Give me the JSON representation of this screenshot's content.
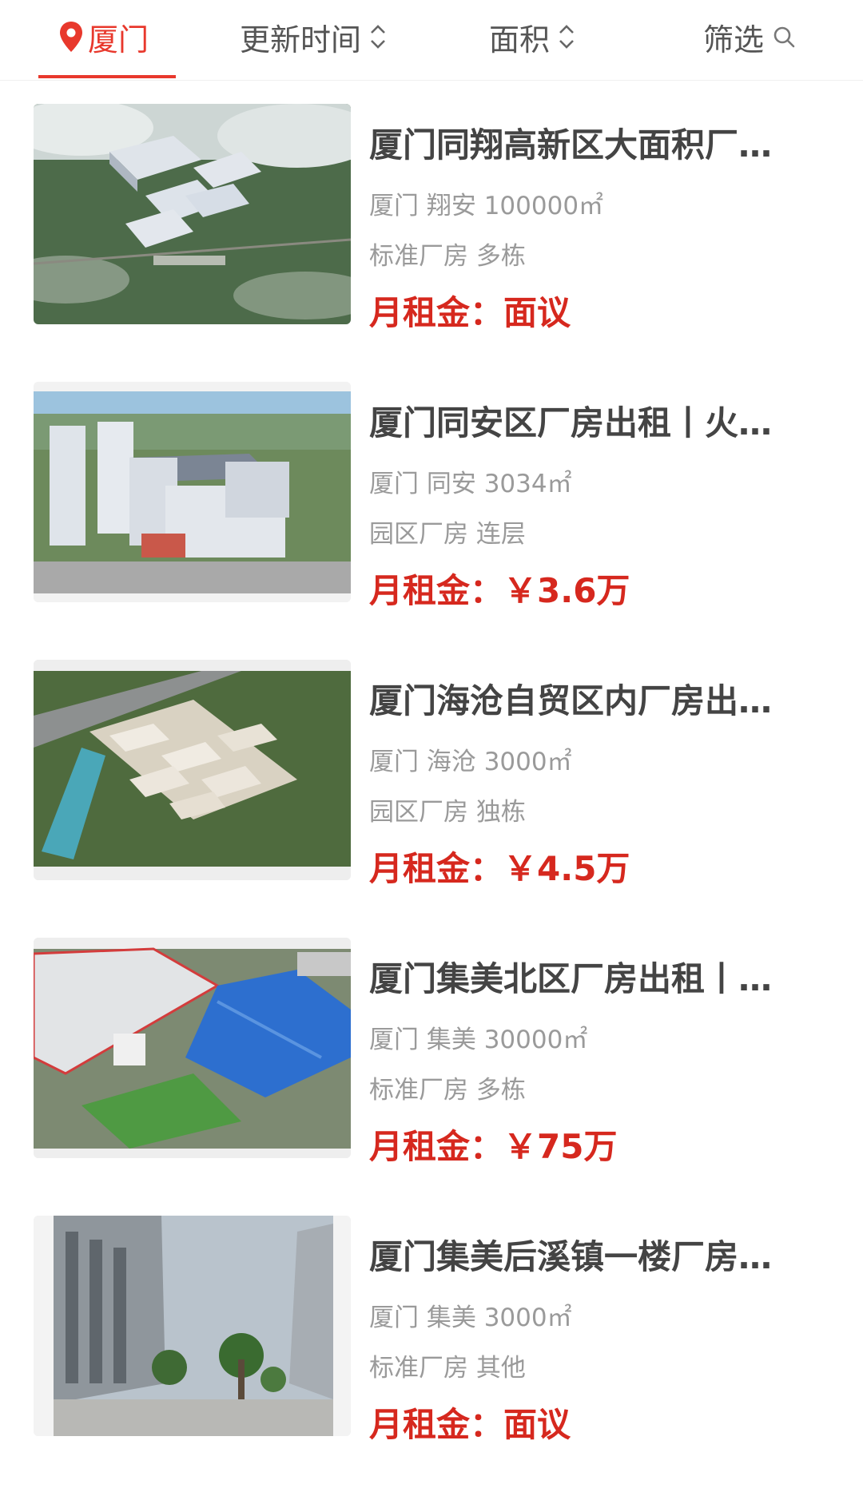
{
  "filter_bar": {
    "city": "厦门",
    "sort_time": "更新时间",
    "sort_area": "面积",
    "filter": "筛选",
    "accent_color": "#e8382c"
  },
  "rent_prefix": "月租金：",
  "listings": [
    {
      "title": "厦门同翔高新区大面积厂…",
      "meta": "厦门 翔安 100000㎡",
      "tags": "标准厂房 多栋",
      "rent": "面议"
    },
    {
      "title": "厦门同安区厂房出租丨火…",
      "meta": "厦门 同安 3034㎡",
      "tags": "园区厂房 连层",
      "rent": "￥3.6万"
    },
    {
      "title": "厦门海沧自贸区内厂房出…",
      "meta": "厦门 海沧 3000㎡",
      "tags": "园区厂房 独栋",
      "rent": "￥4.5万"
    },
    {
      "title": "厦门集美北区厂房出租丨…",
      "meta": "厦门 集美 30000㎡",
      "tags": "标准厂房 多栋",
      "rent": "￥75万"
    },
    {
      "title": "厦门集美后溪镇一楼厂房…",
      "meta": "厦门 集美 3000㎡",
      "tags": "标准厂房 其他",
      "rent": "面议"
    }
  ]
}
